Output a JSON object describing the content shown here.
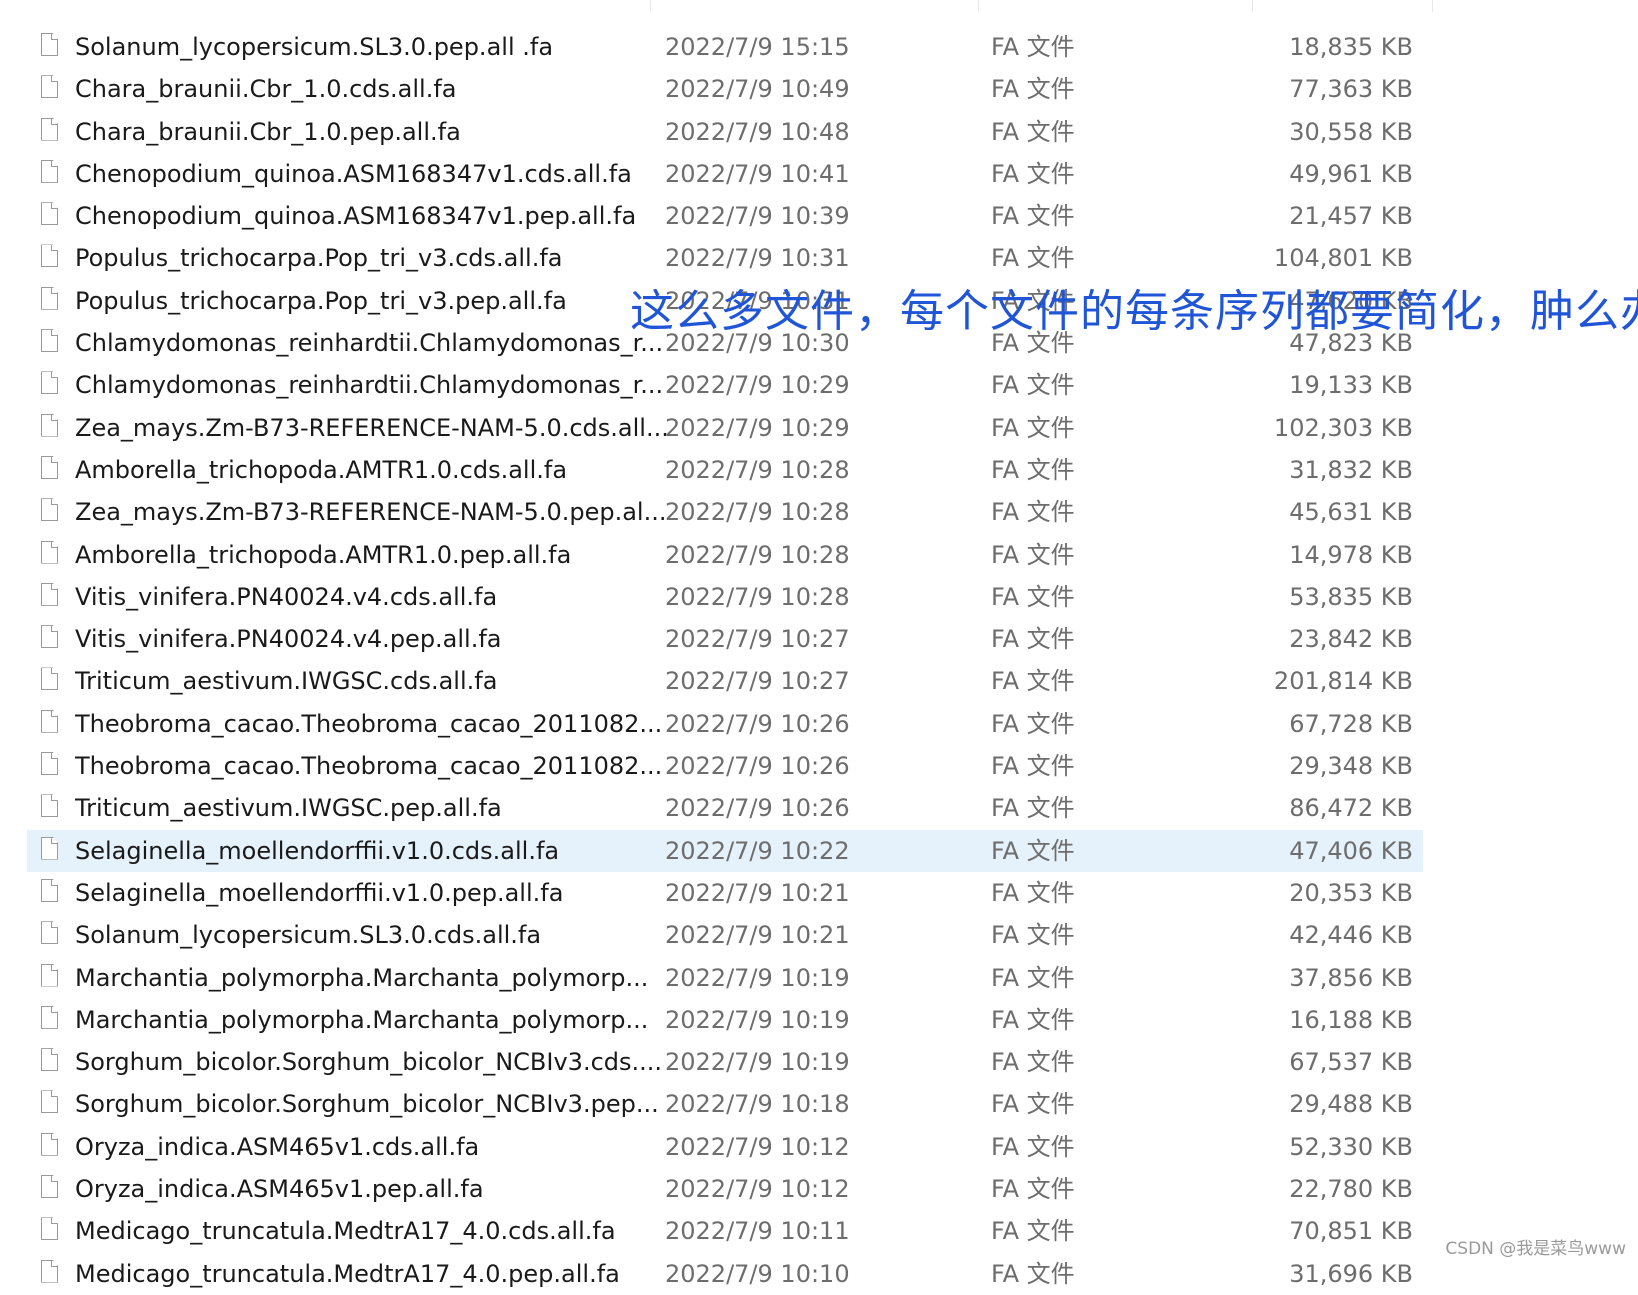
{
  "files": [
    {
      "name": "Solanum_lycopersicum.SL3.0.pep.all .fa",
      "date": "2022/7/9 15:15",
      "type": "FA 文件",
      "size": "18,835 KB"
    },
    {
      "name": "Chara_braunii.Cbr_1.0.cds.all.fa",
      "date": "2022/7/9 10:49",
      "type": "FA 文件",
      "size": "77,363 KB"
    },
    {
      "name": "Chara_braunii.Cbr_1.0.pep.all.fa",
      "date": "2022/7/9 10:48",
      "type": "FA 文件",
      "size": "30,558 KB"
    },
    {
      "name": "Chenopodium_quinoa.ASM168347v1.cds.all.fa",
      "date": "2022/7/9 10:41",
      "type": "FA 文件",
      "size": "49,961 KB"
    },
    {
      "name": "Chenopodium_quinoa.ASM168347v1.pep.all.fa",
      "date": "2022/7/9 10:39",
      "type": "FA 文件",
      "size": "21,457 KB"
    },
    {
      "name": "Populus_trichocarpa.Pop_tri_v3.cds.all.fa",
      "date": "2022/7/9 10:31",
      "type": "FA 文件",
      "size": "104,801 KB"
    },
    {
      "name": "Populus_trichocarpa.Pop_tri_v3.pep.all.fa",
      "date": "2022/7/9 10:31",
      "type": "FA 文件",
      "size": "47,620 KB"
    },
    {
      "name": "Chlamydomonas_reinhardtii.Chlamydomonas_r...",
      "date": "2022/7/9 10:30",
      "type": "FA 文件",
      "size": "47,823 KB"
    },
    {
      "name": "Chlamydomonas_reinhardtii.Chlamydomonas_r...",
      "date": "2022/7/9 10:29",
      "type": "FA 文件",
      "size": "19,133 KB"
    },
    {
      "name": "Zea_mays.Zm-B73-REFERENCE-NAM-5.0.cds.all...",
      "date": "2022/7/9 10:29",
      "type": "FA 文件",
      "size": "102,303 KB"
    },
    {
      "name": "Amborella_trichopoda.AMTR1.0.cds.all.fa",
      "date": "2022/7/9 10:28",
      "type": "FA 文件",
      "size": "31,832 KB"
    },
    {
      "name": "Zea_mays.Zm-B73-REFERENCE-NAM-5.0.pep.al...",
      "date": "2022/7/9 10:28",
      "type": "FA 文件",
      "size": "45,631 KB"
    },
    {
      "name": "Amborella_trichopoda.AMTR1.0.pep.all.fa",
      "date": "2022/7/9 10:28",
      "type": "FA 文件",
      "size": "14,978 KB"
    },
    {
      "name": "Vitis_vinifera.PN40024.v4.cds.all.fa",
      "date": "2022/7/9 10:28",
      "type": "FA 文件",
      "size": "53,835 KB"
    },
    {
      "name": "Vitis_vinifera.PN40024.v4.pep.all.fa",
      "date": "2022/7/9 10:27",
      "type": "FA 文件",
      "size": "23,842 KB"
    },
    {
      "name": "Triticum_aestivum.IWGSC.cds.all.fa",
      "date": "2022/7/9 10:27",
      "type": "FA 文件",
      "size": "201,814 KB"
    },
    {
      "name": "Theobroma_cacao.Theobroma_cacao_2011082...",
      "date": "2022/7/9 10:26",
      "type": "FA 文件",
      "size": "67,728 KB"
    },
    {
      "name": "Theobroma_cacao.Theobroma_cacao_2011082...",
      "date": "2022/7/9 10:26",
      "type": "FA 文件",
      "size": "29,348 KB"
    },
    {
      "name": "Triticum_aestivum.IWGSC.pep.all.fa",
      "date": "2022/7/9 10:26",
      "type": "FA 文件",
      "size": "86,472 KB"
    },
    {
      "name": "Selaginella_moellendorffii.v1.0.cds.all.fa",
      "date": "2022/7/9 10:22",
      "type": "FA 文件",
      "size": "47,406 KB"
    },
    {
      "name": "Selaginella_moellendorffii.v1.0.pep.all.fa",
      "date": "2022/7/9 10:21",
      "type": "FA 文件",
      "size": "20,353 KB"
    },
    {
      "name": "Solanum_lycopersicum.SL3.0.cds.all.fa",
      "date": "2022/7/9 10:21",
      "type": "FA 文件",
      "size": "42,446 KB"
    },
    {
      "name": "Marchantia_polymorpha.Marchanta_polymorp...",
      "date": "2022/7/9 10:19",
      "type": "FA 文件",
      "size": "37,856 KB"
    },
    {
      "name": "Marchantia_polymorpha.Marchanta_polymorp...",
      "date": "2022/7/9 10:19",
      "type": "FA 文件",
      "size": "16,188 KB"
    },
    {
      "name": "Sorghum_bicolor.Sorghum_bicolor_NCBIv3.cds....",
      "date": "2022/7/9 10:19",
      "type": "FA 文件",
      "size": "67,537 KB"
    },
    {
      "name": "Sorghum_bicolor.Sorghum_bicolor_NCBIv3.pep...",
      "date": "2022/7/9 10:18",
      "type": "FA 文件",
      "size": "29,488 KB"
    },
    {
      "name": "Oryza_indica.ASM465v1.cds.all.fa",
      "date": "2022/7/9 10:12",
      "type": "FA 文件",
      "size": "52,330 KB"
    },
    {
      "name": "Oryza_indica.ASM465v1.pep.all.fa",
      "date": "2022/7/9 10:12",
      "type": "FA 文件",
      "size": "22,780 KB"
    },
    {
      "name": "Medicago_truncatula.MedtrA17_4.0.cds.all.fa",
      "date": "2022/7/9 10:11",
      "type": "FA 文件",
      "size": "70,851 KB"
    },
    {
      "name": "Medicago_truncatula.MedtrA17_4.0.pep.all.fa",
      "date": "2022/7/9 10:10",
      "type": "FA 文件",
      "size": "31,696 KB"
    }
  ],
  "selected_index": 19,
  "overlay_caption": "这么多文件，每个文件的每条序列都要简化，肿么办",
  "watermark": "CSDN @我是菜鸟www",
  "colors": {
    "selection": "#e5f1fb",
    "caption": "#1f55d6",
    "secondary_text": "#6d6d6d"
  }
}
